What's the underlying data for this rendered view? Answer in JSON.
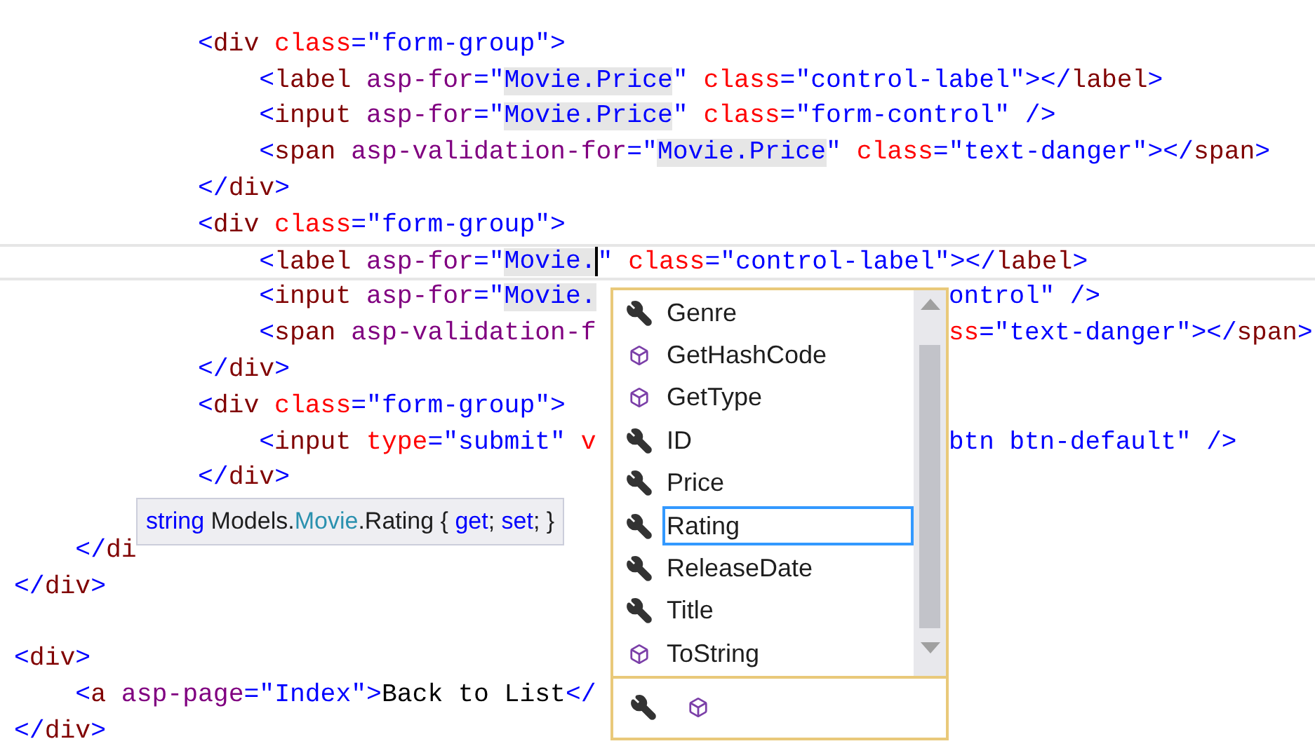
{
  "code_lines": [
    {
      "kind": "code",
      "segments": [
        {
          "text": "            <",
          "kind": "punct"
        },
        {
          "text": "div",
          "kind": "tag"
        },
        {
          "text": " class",
          "kind": "attr"
        },
        {
          "text": "=\"form-group\">",
          "kind": "value"
        }
      ]
    },
    {
      "kind": "code",
      "segments": [
        {
          "text": "                <",
          "kind": "punct"
        },
        {
          "text": "label",
          "kind": "tag"
        },
        {
          "text": " asp-for",
          "kind": "helper"
        },
        {
          "text": "=\"",
          "kind": "value"
        },
        {
          "text": "Movie.Price",
          "kind": "ref"
        },
        {
          "text": "\"",
          "kind": "value"
        },
        {
          "text": " class",
          "kind": "attr"
        },
        {
          "text": "=\"control-label\">",
          "kind": "value"
        },
        {
          "text": "</",
          "kind": "punct"
        },
        {
          "text": "label",
          "kind": "tag"
        },
        {
          "text": ">",
          "kind": "punct"
        }
      ]
    },
    {
      "kind": "code",
      "segments": [
        {
          "text": "                <",
          "kind": "punct"
        },
        {
          "text": "input",
          "kind": "tag"
        },
        {
          "text": " asp-for",
          "kind": "helper"
        },
        {
          "text": "=\"",
          "kind": "value"
        },
        {
          "text": "Movie.Price",
          "kind": "ref"
        },
        {
          "text": "\"",
          "kind": "value"
        },
        {
          "text": " class",
          "kind": "attr"
        },
        {
          "text": "=\"form-control\" />",
          "kind": "value"
        }
      ]
    },
    {
      "kind": "code",
      "segments": [
        {
          "text": "                <",
          "kind": "punct"
        },
        {
          "text": "span",
          "kind": "tag"
        },
        {
          "text": " asp-validation-for",
          "kind": "helper"
        },
        {
          "text": "=\"",
          "kind": "value"
        },
        {
          "text": "Movie.Price",
          "kind": "ref"
        },
        {
          "text": "\"",
          "kind": "value"
        },
        {
          "text": " class",
          "kind": "attr"
        },
        {
          "text": "=\"text-danger\">",
          "kind": "value"
        },
        {
          "text": "</",
          "kind": "punct"
        },
        {
          "text": "span",
          "kind": "tag"
        },
        {
          "text": ">",
          "kind": "punct"
        }
      ]
    },
    {
      "kind": "code",
      "segments": [
        {
          "text": "            </",
          "kind": "punct"
        },
        {
          "text": "div",
          "kind": "tag"
        },
        {
          "text": ">",
          "kind": "punct"
        }
      ]
    },
    {
      "kind": "code",
      "segments": [
        {
          "text": "            <",
          "kind": "punct"
        },
        {
          "text": "div",
          "kind": "tag"
        },
        {
          "text": " class",
          "kind": "attr"
        },
        {
          "text": "=\"form-group\">",
          "kind": "value"
        }
      ]
    },
    {
      "kind": "code",
      "current": true,
      "segments": [
        {
          "text": "                <",
          "kind": "punct"
        },
        {
          "text": "label",
          "kind": "tag"
        },
        {
          "text": " asp-for",
          "kind": "helper"
        },
        {
          "text": "=\"",
          "kind": "value"
        },
        {
          "text": "Movie.",
          "kind": "ref",
          "caret": true
        },
        {
          "text": "\"",
          "kind": "value"
        },
        {
          "text": " class",
          "kind": "attr"
        },
        {
          "text": "=\"control-label\">",
          "kind": "value"
        },
        {
          "text": "</",
          "kind": "punct"
        },
        {
          "text": "label",
          "kind": "tag"
        },
        {
          "text": ">",
          "kind": "punct"
        }
      ]
    },
    {
      "kind": "code",
      "segments": [
        {
          "text": "                <",
          "kind": "punct"
        },
        {
          "text": "input",
          "kind": "tag"
        },
        {
          "text": " asp-for",
          "kind": "helper"
        },
        {
          "text": "=\"",
          "kind": "value"
        },
        {
          "text": "Movie.",
          "kind": "ref"
        }
      ],
      "tail": [
        {
          "text": "ontrol\" />",
          "kind": "value"
        }
      ]
    },
    {
      "kind": "code",
      "segments": [
        {
          "text": "                <",
          "kind": "punct"
        },
        {
          "text": "span",
          "kind": "tag"
        },
        {
          "text": " asp-validation-f",
          "kind": "helper"
        }
      ],
      "tail": [
        {
          "text": "ss",
          "kind": "attr"
        },
        {
          "text": "=\"text-danger\">",
          "kind": "value"
        },
        {
          "text": "</",
          "kind": "punct"
        },
        {
          "text": "span",
          "kind": "tag"
        },
        {
          "text": ">",
          "kind": "punct"
        }
      ]
    },
    {
      "kind": "code",
      "segments": [
        {
          "text": "            </",
          "kind": "punct"
        },
        {
          "text": "div",
          "kind": "tag"
        },
        {
          "text": ">",
          "kind": "punct"
        }
      ]
    },
    {
      "kind": "code",
      "segments": [
        {
          "text": "            <",
          "kind": "punct"
        },
        {
          "text": "div",
          "kind": "tag"
        },
        {
          "text": " class",
          "kind": "attr"
        },
        {
          "text": "=\"form-group\">",
          "kind": "value"
        }
      ]
    },
    {
      "kind": "code",
      "segments": [
        {
          "text": "                <",
          "kind": "punct"
        },
        {
          "text": "input",
          "kind": "tag"
        },
        {
          "text": " type",
          "kind": "attr"
        },
        {
          "text": "=\"submit\"",
          "kind": "value"
        },
        {
          "text": " v",
          "kind": "attr"
        }
      ],
      "tail": [
        {
          "text": "btn btn-default\" />",
          "kind": "value"
        }
      ]
    },
    {
      "kind": "code",
      "segments": [
        {
          "text": "            </",
          "kind": "punct"
        },
        {
          "text": "div",
          "kind": "tag"
        },
        {
          "text": ">",
          "kind": "punct"
        }
      ]
    },
    {
      "kind": "blank"
    },
    {
      "kind": "code",
      "segments": [
        {
          "text": "    </",
          "kind": "punct"
        },
        {
          "text": "di",
          "kind": "tag"
        }
      ]
    },
    {
      "kind": "code",
      "segments": [
        {
          "text": "</",
          "kind": "punct"
        },
        {
          "text": "div",
          "kind": "tag"
        },
        {
          "text": ">",
          "kind": "punct"
        }
      ]
    },
    {
      "kind": "blank"
    },
    {
      "kind": "code",
      "segments": [
        {
          "text": "<",
          "kind": "punct"
        },
        {
          "text": "div",
          "kind": "tag"
        },
        {
          "text": ">",
          "kind": "punct"
        }
      ]
    },
    {
      "kind": "code",
      "segments": [
        {
          "text": "    <",
          "kind": "punct"
        },
        {
          "text": "a",
          "kind": "tag"
        },
        {
          "text": " asp-page",
          "kind": "helper"
        },
        {
          "text": "=\"Index\">",
          "kind": "value"
        },
        {
          "text": "Back to List",
          "kind": "text"
        },
        {
          "text": "</",
          "kind": "punct"
        }
      ]
    },
    {
      "kind": "code",
      "segments": [
        {
          "text": "</",
          "kind": "punct"
        },
        {
          "text": "div",
          "kind": "tag"
        },
        {
          "text": ">",
          "kind": "punct"
        }
      ]
    }
  ],
  "tooltip": [
    {
      "text": "string",
      "kind": "keyword"
    },
    {
      "text": " Models.",
      "kind": "text"
    },
    {
      "text": "Movie",
      "kind": "type"
    },
    {
      "text": ".Rating { ",
      "kind": "text"
    },
    {
      "text": "get",
      "kind": "keyword"
    },
    {
      "text": "; ",
      "kind": "text"
    },
    {
      "text": "set",
      "kind": "keyword"
    },
    {
      "text": "; }",
      "kind": "text"
    }
  ],
  "completion": {
    "items": [
      {
        "label": "Genre",
        "kind": "property",
        "selected": false
      },
      {
        "label": "GetHashCode",
        "kind": "method",
        "selected": false
      },
      {
        "label": "GetType",
        "kind": "method",
        "selected": false
      },
      {
        "label": "ID",
        "kind": "property",
        "selected": false
      },
      {
        "label": "Price",
        "kind": "property",
        "selected": false
      },
      {
        "label": "Rating",
        "kind": "property",
        "selected": true
      },
      {
        "label": "ReleaseDate",
        "kind": "property",
        "selected": false
      },
      {
        "label": "Title",
        "kind": "property",
        "selected": false
      },
      {
        "label": "ToString",
        "kind": "method",
        "selected": false
      }
    ],
    "filters": [
      {
        "kind": "property"
      },
      {
        "kind": "method"
      }
    ]
  }
}
